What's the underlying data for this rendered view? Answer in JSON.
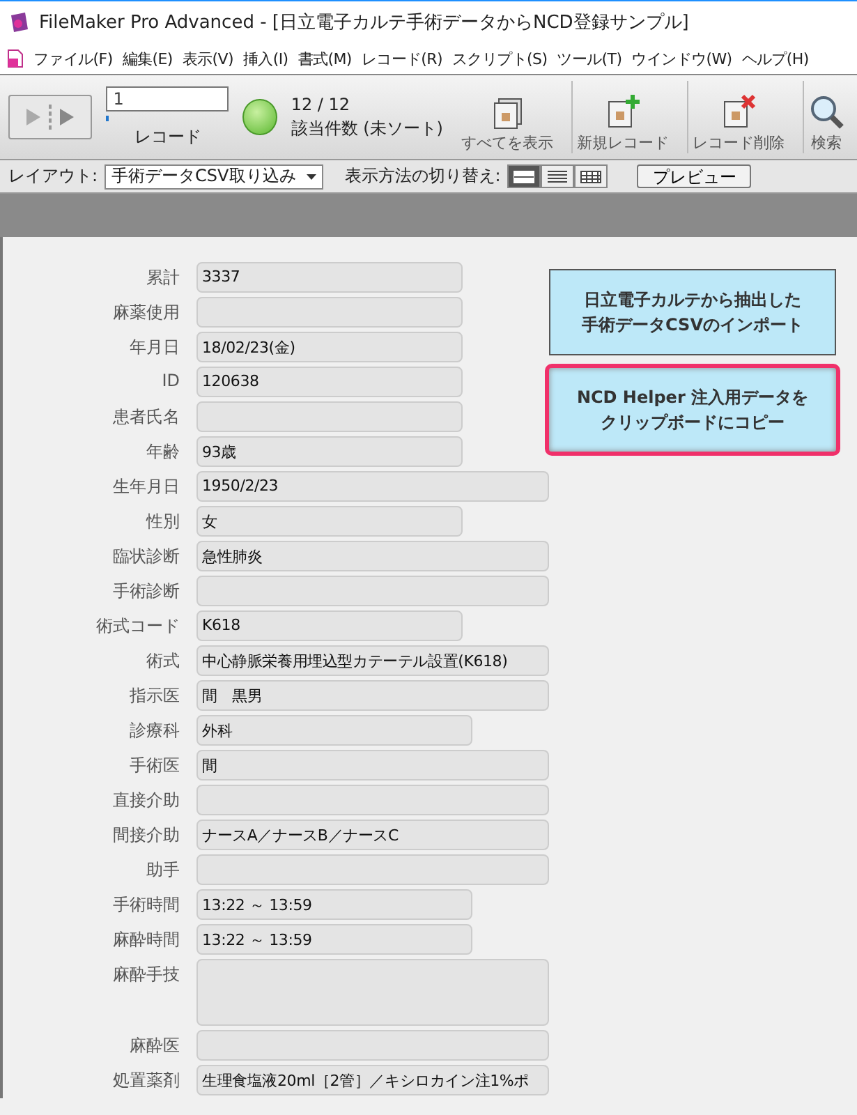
{
  "window": {
    "title": "FileMaker Pro Advanced - [日立電子カルテ手術データからNCD登録サンプル]"
  },
  "menu": [
    "ファイル(F)",
    "編集(E)",
    "表示(V)",
    "挿入(I)",
    "書式(M)",
    "レコード(R)",
    "スクリプト(S)",
    "ツール(T)",
    "ウインドウ(W)",
    "ヘルプ(H)"
  ],
  "toolbar": {
    "record_field": "1",
    "record_label": "レコード",
    "found_count": "12 / 12",
    "found_label": "該当件数 (未ソート)",
    "buttons": [
      {
        "kind": "show-all",
        "label": "すべてを表示"
      },
      {
        "kind": "new",
        "label": "新規レコード"
      },
      {
        "kind": "delete",
        "label": "レコード削除"
      },
      {
        "kind": "find",
        "label": "検索"
      }
    ]
  },
  "layout_bar": {
    "layout_label": "レイアウト:",
    "layout_value": "手術データCSV取り込み",
    "view_label": "表示方法の切り替え:",
    "views": [
      {
        "kind": "form",
        "selected": true
      },
      {
        "kind": "list",
        "selected": false
      },
      {
        "kind": "table",
        "selected": false
      }
    ],
    "preview_button": "プレビュー"
  },
  "form": {
    "fields": [
      {
        "label": "累計",
        "value": "3337",
        "kind": "short"
      },
      {
        "label": "麻薬使用",
        "kind": "short"
      },
      {
        "label": "年月日",
        "value": "18/02/23(金)",
        "kind": "short"
      },
      {
        "label": "ID",
        "value": "120638",
        "kind": "short"
      },
      {
        "label": "患者氏名",
        "kind": "short"
      },
      {
        "label": "年齢",
        "value": "93歳",
        "kind": "short"
      },
      {
        "label": "生年月日",
        "value": "1950/2/23",
        "kind": "long"
      },
      {
        "label": "性別",
        "value": "女",
        "kind": "short"
      },
      {
        "label": "臨状診断",
        "value": "急性肺炎",
        "kind": "long"
      },
      {
        "label": "手術診断",
        "kind": "long"
      },
      {
        "label": "術式コード",
        "value": "K618",
        "kind": "short"
      },
      {
        "label": "術式",
        "value": "中心静脈栄養用埋込型カテーテル設置(K618)",
        "kind": "long"
      },
      {
        "label": "指示医",
        "value": "間　黒男",
        "kind": "long"
      },
      {
        "label": "診療科",
        "value": "外科",
        "kind": "medium"
      },
      {
        "label": "手術医",
        "value": "間",
        "kind": "long"
      },
      {
        "label": "直接介助",
        "kind": "long"
      },
      {
        "label": "間接介助",
        "value": "ナースA／ナースB／ナースC",
        "kind": "long"
      },
      {
        "label": "助手",
        "kind": "long"
      },
      {
        "label": "手術時間",
        "value": "13:22 ～ 13:59",
        "kind": "medium"
      },
      {
        "label": "麻酔時間",
        "value": "13:22 ～ 13:59",
        "kind": "medium"
      },
      {
        "label": "麻酔手技",
        "kind": "tall"
      },
      {
        "label": "麻酔医",
        "kind": "long"
      },
      {
        "label": "処置薬剤",
        "value": "生理食塩液20ml［2管］／キシロカイン注1%ポ",
        "kind": "long"
      }
    ],
    "actions": [
      {
        "label_lines": [
          "日立電子カルテから抽出した",
          "手術データCSVのインポート"
        ],
        "highlighted": false
      },
      {
        "label_lines": [
          "NCD Helper 注入用データを",
          "クリップボードにコピー"
        ],
        "highlighted": true
      }
    ]
  }
}
